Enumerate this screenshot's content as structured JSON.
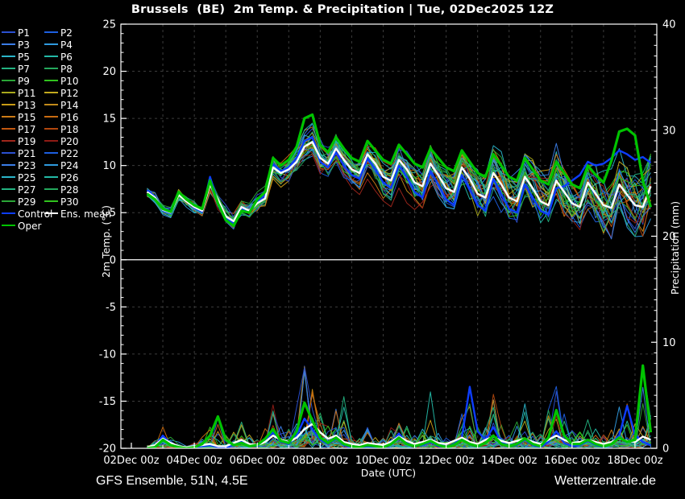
{
  "title": "Brussels  (BE)  2m Temp. & Precipitation | Tue, 02Dec2025 12Z",
  "footer": {
    "left": "GFS Ensemble, 51N, 4.5E",
    "right": "Wetterzentrale.de"
  },
  "colors": {
    "background": "#000000",
    "frame": "#ffffff",
    "grid": "#3c3c3c",
    "zero_line": "#ffffff",
    "control": "#0d3dff",
    "ens_mean": "#ffffff",
    "oper": "#00c300"
  },
  "legend": {
    "members": [
      {
        "label": "P1",
        "color": "#2b50d0"
      },
      {
        "label": "P2",
        "color": "#1d5fe0"
      },
      {
        "label": "P3",
        "color": "#3b7de8"
      },
      {
        "label": "P4",
        "color": "#2f9ade"
      },
      {
        "label": "P5",
        "color": "#2ab5c9"
      },
      {
        "label": "P6",
        "color": "#23b9a6"
      },
      {
        "label": "P7",
        "color": "#23b381"
      },
      {
        "label": "P8",
        "color": "#24a85d"
      },
      {
        "label": "P9",
        "color": "#2aa636"
      },
      {
        "label": "P10",
        "color": "#31c31e"
      },
      {
        "label": "P11",
        "color": "#a9a91c"
      },
      {
        "label": "P12",
        "color": "#c3aa1e"
      },
      {
        "label": "P13",
        "color": "#c99c15"
      },
      {
        "label": "P14",
        "color": "#c28a1b"
      },
      {
        "label": "P15",
        "color": "#cc7b15"
      },
      {
        "label": "P16",
        "color": "#c96b11"
      },
      {
        "label": "P17",
        "color": "#c2580f"
      },
      {
        "label": "P18",
        "color": "#b2470d"
      },
      {
        "label": "P19",
        "color": "#a1261b"
      },
      {
        "label": "P20",
        "color": "#8f1b15"
      },
      {
        "label": "P21",
        "color": "#2b50d0"
      },
      {
        "label": "P22",
        "color": "#1d5fe0"
      },
      {
        "label": "P23",
        "color": "#3b7de8"
      },
      {
        "label": "P24",
        "color": "#2f9ade"
      },
      {
        "label": "P25",
        "color": "#2ab5c9"
      },
      {
        "label": "P26",
        "color": "#23b9a6"
      },
      {
        "label": "P27",
        "color": "#23b381"
      },
      {
        "label": "P28",
        "color": "#24a85d"
      },
      {
        "label": "P29",
        "color": "#2aa636"
      },
      {
        "label": "P30",
        "color": "#31c31e"
      }
    ],
    "special": [
      {
        "label": "Control",
        "color": "#0d3dff"
      },
      {
        "label": "Ens. mean",
        "color": "#ffffff"
      },
      {
        "label": "Oper",
        "color": "#00c300"
      }
    ]
  },
  "chart_data": {
    "type": "line",
    "title": "Brussels  (BE)  2m Temp. & Precipitation | Tue, 02Dec2025 12Z",
    "x_axis": {
      "label": "Date (UTC)",
      "tick_labels": [
        "02Dec 00z",
        "04Dec 00z",
        "06Dec 00z",
        "08Dec 00z",
        "10Dec 00z",
        "12Dec 00z",
        "14Dec 00z",
        "16Dec 00z",
        "18Dec 00z"
      ],
      "tick_days": [
        0,
        2,
        4,
        6,
        8,
        10,
        12,
        14,
        16
      ],
      "minor_tick_days": [
        1,
        3,
        5,
        7,
        9,
        11,
        13,
        15
      ],
      "grid_days": [
        1,
        2,
        3,
        4,
        5,
        6,
        7,
        8,
        9,
        10,
        11,
        12,
        13,
        14,
        15,
        16
      ]
    },
    "y_left": {
      "label": "2m Temp. (°C)",
      "min": -20,
      "max": 25,
      "ticks": [
        25,
        20,
        15,
        10,
        5,
        0,
        -5,
        -10,
        -15,
        -20
      ],
      "grid_at": [
        20,
        15,
        10,
        5,
        -5,
        -10,
        -15
      ],
      "zero_line": 0
    },
    "y_right": {
      "label": "Precipitation (mm)",
      "min": 0,
      "max": 40,
      "ticks": [
        40,
        30,
        20,
        10,
        0
      ]
    },
    "time": {
      "t0_days": 0.5,
      "dt_days": 0.25,
      "n": 65
    },
    "series": {
      "ens_mean_temp": [
        7.2,
        6.6,
        5.3,
        5.0,
        6.9,
        6.2,
        5.6,
        5.2,
        8.0,
        6.4,
        4.6,
        4.1,
        5.6,
        5.2,
        6.0,
        6.5,
        9.8,
        9.2,
        9.6,
        10.4,
        12.0,
        12.5,
        10.8,
        10.2,
        11.8,
        10.6,
        9.6,
        9.2,
        11.2,
        10.2,
        8.8,
        8.4,
        10.6,
        9.6,
        8.2,
        7.8,
        10.2,
        9.0,
        7.6,
        7.2,
        9.8,
        8.6,
        7.0,
        6.6,
        9.2,
        8.0,
        6.6,
        6.2,
        8.8,
        7.6,
        6.2,
        5.8,
        8.4,
        7.2,
        6.0,
        5.6,
        8.2,
        7.0,
        5.8,
        5.5,
        8.0,
        6.9,
        5.8,
        5.6,
        7.8
      ],
      "control_temp": [
        7.4,
        6.7,
        5.2,
        4.9,
        7.0,
        6.3,
        5.5,
        5.1,
        8.8,
        6.2,
        4.4,
        3.9,
        5.4,
        5.0,
        6.2,
        6.8,
        10.2,
        9.4,
        9.8,
        10.8,
        12.6,
        13.0,
        10.4,
        9.8,
        11.4,
        10.0,
        9.0,
        8.6,
        10.8,
        9.6,
        8.2,
        7.6,
        10.0,
        8.8,
        7.2,
        6.6,
        9.4,
        8.0,
        6.4,
        5.8,
        9.0,
        7.4,
        5.8,
        5.2,
        8.6,
        7.0,
        5.4,
        5.0,
        8.0,
        6.6,
        5.2,
        4.8,
        7.6,
        7.8,
        8.4,
        9.0,
        10.4,
        10.0,
        10.2,
        10.8,
        11.6,
        11.2,
        10.6,
        10.9,
        10.3
      ],
      "oper_temp": [
        7.0,
        6.4,
        5.4,
        5.1,
        7.2,
        6.4,
        5.8,
        5.4,
        8.4,
        6.0,
        4.2,
        3.6,
        5.2,
        5.0,
        6.4,
        7.2,
        10.8,
        10.0,
        10.6,
        12.0,
        15.0,
        15.4,
        12.2,
        11.4,
        13.0,
        11.8,
        10.8,
        10.4,
        12.6,
        11.6,
        10.6,
        10.2,
        12.2,
        11.2,
        10.2,
        9.8,
        11.8,
        10.8,
        9.8,
        9.4,
        11.6,
        10.4,
        9.2,
        8.8,
        11.2,
        10.0,
        8.8,
        8.4,
        10.8,
        9.6,
        8.4,
        8.0,
        10.4,
        9.2,
        8.0,
        7.6,
        10.0,
        9.0,
        8.2,
        10.5,
        13.6,
        13.9,
        13.2,
        8.4,
        5.6
      ],
      "ensemble_temp_min": [
        6.4,
        5.8,
        4.4,
        4.1,
        6.0,
        5.2,
        4.5,
        4.1,
        6.8,
        4.7,
        3.4,
        2.6,
        4.2,
        3.8,
        4.4,
        4.8,
        7.8,
        7.0,
        7.2,
        7.8,
        9.2,
        9.6,
        7.8,
        7.2,
        8.6,
        7.2,
        6.2,
        5.6,
        7.6,
        6.4,
        5.2,
        4.6,
        6.6,
        5.4,
        4.2,
        3.6,
        5.8,
        4.4,
        3.2,
        2.6,
        5.0,
        3.6,
        2.2,
        1.6,
        4.2,
        2.8,
        1.4,
        0.8,
        3.6,
        2.2,
        0.8,
        0.2,
        3.0,
        1.6,
        0.4,
        -0.2,
        2.6,
        1.2,
        0.0,
        -0.6,
        2.2,
        0.8,
        -0.4,
        -1.0,
        1.2
      ],
      "ensemble_temp_max": [
        8.0,
        7.4,
        6.2,
        5.9,
        7.8,
        7.2,
        6.7,
        6.3,
        9.4,
        7.1,
        6.2,
        5.8,
        7.0,
        6.6,
        7.6,
        8.4,
        12.0,
        11.4,
        12.0,
        13.0,
        14.6,
        15.2,
        13.6,
        13.0,
        14.4,
        13.4,
        12.6,
        12.2,
        14.0,
        13.2,
        12.4,
        12.0,
        13.8,
        13.0,
        12.2,
        11.8,
        13.6,
        12.8,
        12.0,
        11.6,
        13.6,
        12.8,
        12.0,
        11.6,
        13.6,
        12.6,
        11.8,
        11.4,
        13.6,
        12.6,
        11.8,
        11.4,
        13.8,
        12.8,
        12.0,
        11.6,
        14.0,
        13.0,
        12.2,
        12.0,
        14.4,
        14.2,
        13.6,
        12.6,
        14.6
      ],
      "ens_mean_precip": [
        0.1,
        0.3,
        0.9,
        0.5,
        0.2,
        0.1,
        0.2,
        0.3,
        0.4,
        0.2,
        0.2,
        0.5,
        0.8,
        0.4,
        0.3,
        0.6,
        1.2,
        0.8,
        0.6,
        1.0,
        1.8,
        2.3,
        1.5,
        0.9,
        1.2,
        0.6,
        0.4,
        0.3,
        0.5,
        0.4,
        0.3,
        0.6,
        1.1,
        0.7,
        0.4,
        0.6,
        0.8,
        0.5,
        0.4,
        0.7,
        1.0,
        0.6,
        0.4,
        0.8,
        1.1,
        0.7,
        0.5,
        0.7,
        0.9,
        0.6,
        0.4,
        0.8,
        1.2,
        0.8,
        0.5,
        0.6,
        0.8,
        0.6,
        0.4,
        0.6,
        0.9,
        0.7,
        0.6,
        1.1,
        0.8
      ],
      "control_precip": [
        0.0,
        0.2,
        1.2,
        0.4,
        0.1,
        0.0,
        0.1,
        0.2,
        0.3,
        0.1,
        0.0,
        0.4,
        0.6,
        0.2,
        0.2,
        0.8,
        1.5,
        0.6,
        0.4,
        1.2,
        2.8,
        1.8,
        0.8,
        0.4,
        0.9,
        0.3,
        0.1,
        0.0,
        0.2,
        0.1,
        0.1,
        0.5,
        1.4,
        0.5,
        0.2,
        0.3,
        0.6,
        0.2,
        0.1,
        0.4,
        1.0,
        5.8,
        1.6,
        0.8,
        2.0,
        0.6,
        0.2,
        0.3,
        0.8,
        0.3,
        0.1,
        0.6,
        1.6,
        0.5,
        0.2,
        0.3,
        0.7,
        0.3,
        0.1,
        0.5,
        1.2,
        4.0,
        1.2,
        0.6,
        0.3
      ],
      "oper_precip": [
        0.0,
        0.1,
        0.8,
        0.3,
        0.1,
        0.0,
        0.1,
        0.4,
        1.2,
        3.0,
        0.8,
        0.3,
        0.5,
        0.2,
        0.3,
        0.9,
        1.8,
        0.7,
        0.5,
        1.6,
        4.3,
        2.6,
        1.0,
        0.5,
        1.0,
        0.4,
        0.2,
        0.1,
        0.3,
        0.2,
        0.1,
        0.4,
        1.0,
        0.4,
        0.2,
        0.4,
        0.7,
        0.3,
        0.1,
        0.3,
        0.8,
        0.4,
        0.2,
        0.5,
        1.2,
        0.4,
        0.2,
        0.4,
        0.9,
        0.4,
        0.2,
        1.0,
        3.6,
        1.2,
        0.4,
        0.4,
        0.8,
        0.4,
        0.2,
        0.4,
        1.0,
        0.6,
        0.8,
        7.8,
        1.5
      ],
      "ensemble_precip_max": [
        0.3,
        0.8,
        2.6,
        1.4,
        0.6,
        0.3,
        0.5,
        1.2,
        2.2,
        3.4,
        1.6,
        1.8,
        3.2,
        1.6,
        1.2,
        2.6,
        4.4,
        2.4,
        2.0,
        4.2,
        9.7,
        6.4,
        3.4,
        2.2,
        4.0,
        6.2,
        1.6,
        1.0,
        2.0,
        1.4,
        1.2,
        2.4,
        4.6,
        2.2,
        1.4,
        2.8,
        5.8,
        2.0,
        1.2,
        2.2,
        4.0,
        6.0,
        2.4,
        3.0,
        5.2,
        2.4,
        1.6,
        2.6,
        4.4,
        2.2,
        1.4,
        4.0,
        9.3,
        3.6,
        1.8,
        2.2,
        3.8,
        2.0,
        1.4,
        2.4,
        4.4,
        5.0,
        3.0,
        8.5,
        3.2
      ]
    },
    "legend_entries": [
      "P1",
      "P2",
      "P3",
      "P4",
      "P5",
      "P6",
      "P7",
      "P8",
      "P9",
      "P10",
      "P11",
      "P12",
      "P13",
      "P14",
      "P15",
      "P16",
      "P17",
      "P18",
      "P19",
      "P20",
      "P21",
      "P22",
      "P23",
      "P24",
      "P25",
      "P26",
      "P27",
      "P28",
      "P29",
      "P30",
      "Control",
      "Ens. mean",
      "Oper"
    ],
    "layout_hints": {
      "grid": true,
      "legend_position": "top-left",
      "n_members": 30
    }
  }
}
